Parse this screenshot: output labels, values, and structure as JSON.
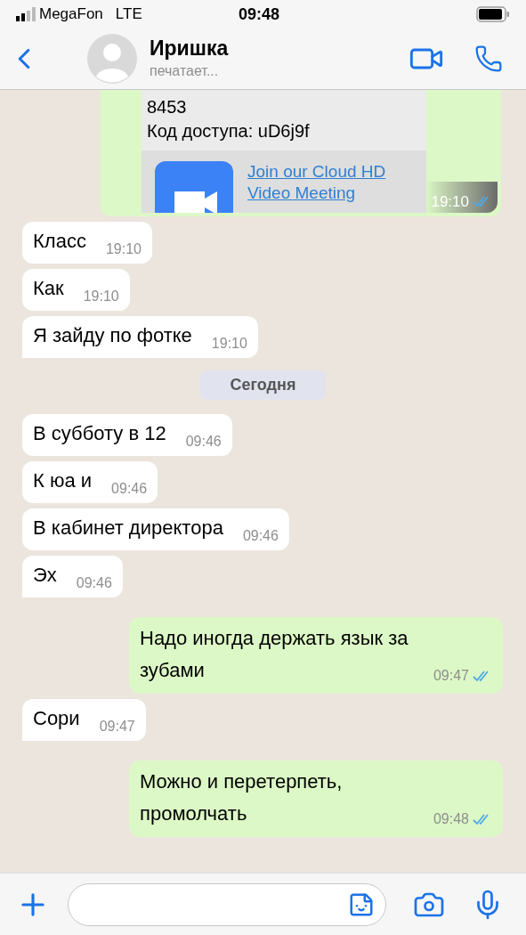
{
  "status_bar": {
    "carrier": "MegaFon",
    "network": "LTE",
    "time": "09:48"
  },
  "header": {
    "name": "Иришка",
    "status": "печатает..."
  },
  "messages": [
    {
      "kind": "link_preview",
      "lines": [
        "8453",
        "Код доступа: uD6j9f"
      ],
      "link": "Join our Cloud HD Video Meeting",
      "time": "19:10",
      "read": true
    },
    {
      "kind": "incoming",
      "text": "Класс",
      "time": "19:10"
    },
    {
      "kind": "incoming",
      "text": "Как",
      "time": "19:10"
    },
    {
      "kind": "incoming",
      "text": "Я зайду по фотке",
      "time": "19:10",
      "tail": true
    },
    {
      "kind": "date",
      "text": "Сегодня"
    },
    {
      "kind": "incoming",
      "text": "В субботу в 12",
      "time": "09:46"
    },
    {
      "kind": "incoming",
      "text": "К юа и",
      "time": "09:46"
    },
    {
      "kind": "incoming",
      "text": "В кабинет директора",
      "time": "09:46"
    },
    {
      "kind": "incoming",
      "text": "Эх",
      "time": "09:46",
      "tail": true
    },
    {
      "kind": "outgoing",
      "text": "Надо иногда держать язык за зубами",
      "time": "09:47",
      "read": true
    },
    {
      "kind": "incoming",
      "text": "Сори",
      "time": "09:47",
      "tail": true
    },
    {
      "kind": "outgoing",
      "text": "Можно и перетерпеть, промолчать",
      "time": "09:48",
      "read": true
    }
  ]
}
